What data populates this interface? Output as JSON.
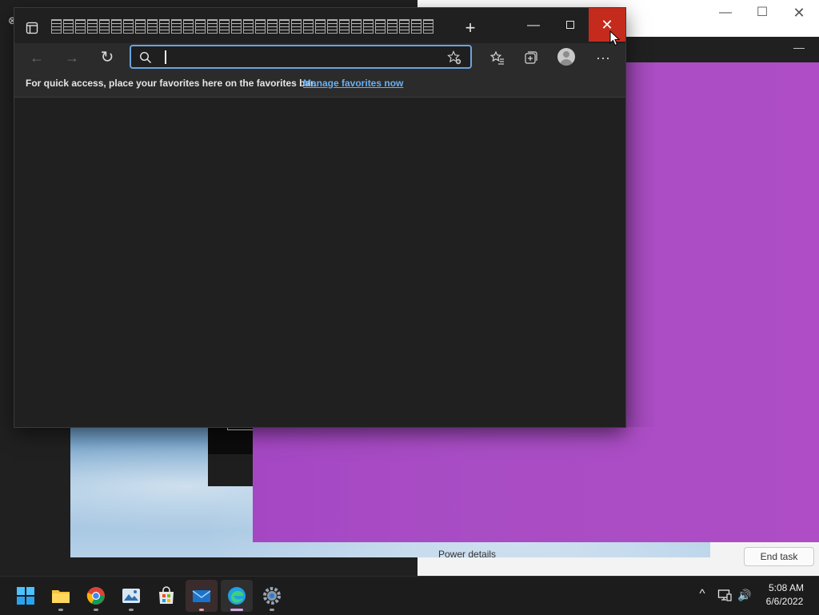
{
  "background_windows": {
    "right_window": {
      "footer_text": "Power details",
      "end_task_label": "End task"
    }
  },
  "edge": {
    "tab_count": 32,
    "new_tab_symbol": "+",
    "window_controls": {
      "minimize": "—",
      "close": "✕"
    },
    "toolbar": {
      "back": "←",
      "forward": "→",
      "refresh": "↻",
      "address_value": "",
      "address_placeholder": "",
      "favorites_icon": "star-list-icon",
      "collections_icon": "collections-icon",
      "more": "···"
    },
    "favorites_bar": {
      "message": "For quick access, place your favorites here on the favorites bar.",
      "link": "Manage favorites now"
    }
  },
  "taskbar": {
    "apps": [
      "start-icon",
      "file-explorer-icon",
      "chrome-icon",
      "photos-icon",
      "store-icon",
      "mail-icon",
      "edge-icon",
      "settings-icon"
    ],
    "tray": {
      "chevron": "^",
      "volume": "🔊"
    },
    "time": "5:08 AM",
    "date": "6/6/2022"
  },
  "colors": {
    "accent_close": "#c42b1c",
    "link": "#6ab0f0",
    "address_focus": "#6aa3e0",
    "purple_panel": "#a94dc5"
  }
}
